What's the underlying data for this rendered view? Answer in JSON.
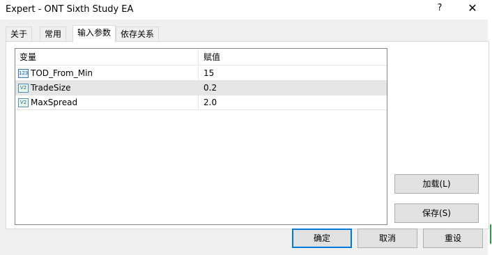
{
  "window": {
    "title": "Expert - ONT Sixth Study EA",
    "help_label": "?",
    "close_label": "✕"
  },
  "tabs": [
    {
      "label": "关于",
      "active": false
    },
    {
      "label": "常用",
      "active": false
    },
    {
      "label": "输入参数",
      "active": true
    },
    {
      "label": "依存关系",
      "active": false
    }
  ],
  "grid": {
    "columns": [
      "变量",
      "赋值"
    ],
    "rows": [
      {
        "icon": "integer-type-icon",
        "icon_text": "123",
        "name": "TOD_From_Min",
        "value": "15",
        "selected": false
      },
      {
        "icon": "double-type-icon",
        "icon_text": "V2",
        "name": "TradeSize",
        "value": "0.2",
        "selected": true
      },
      {
        "icon": "double-type-icon",
        "icon_text": "V2",
        "name": "MaxSpread",
        "value": "2.0",
        "selected": false
      }
    ]
  },
  "side_buttons": {
    "load": "加载(L)",
    "save": "保存(S)"
  },
  "bottom_buttons": {
    "ok": "确定",
    "cancel": "取消",
    "reset": "重设"
  }
}
